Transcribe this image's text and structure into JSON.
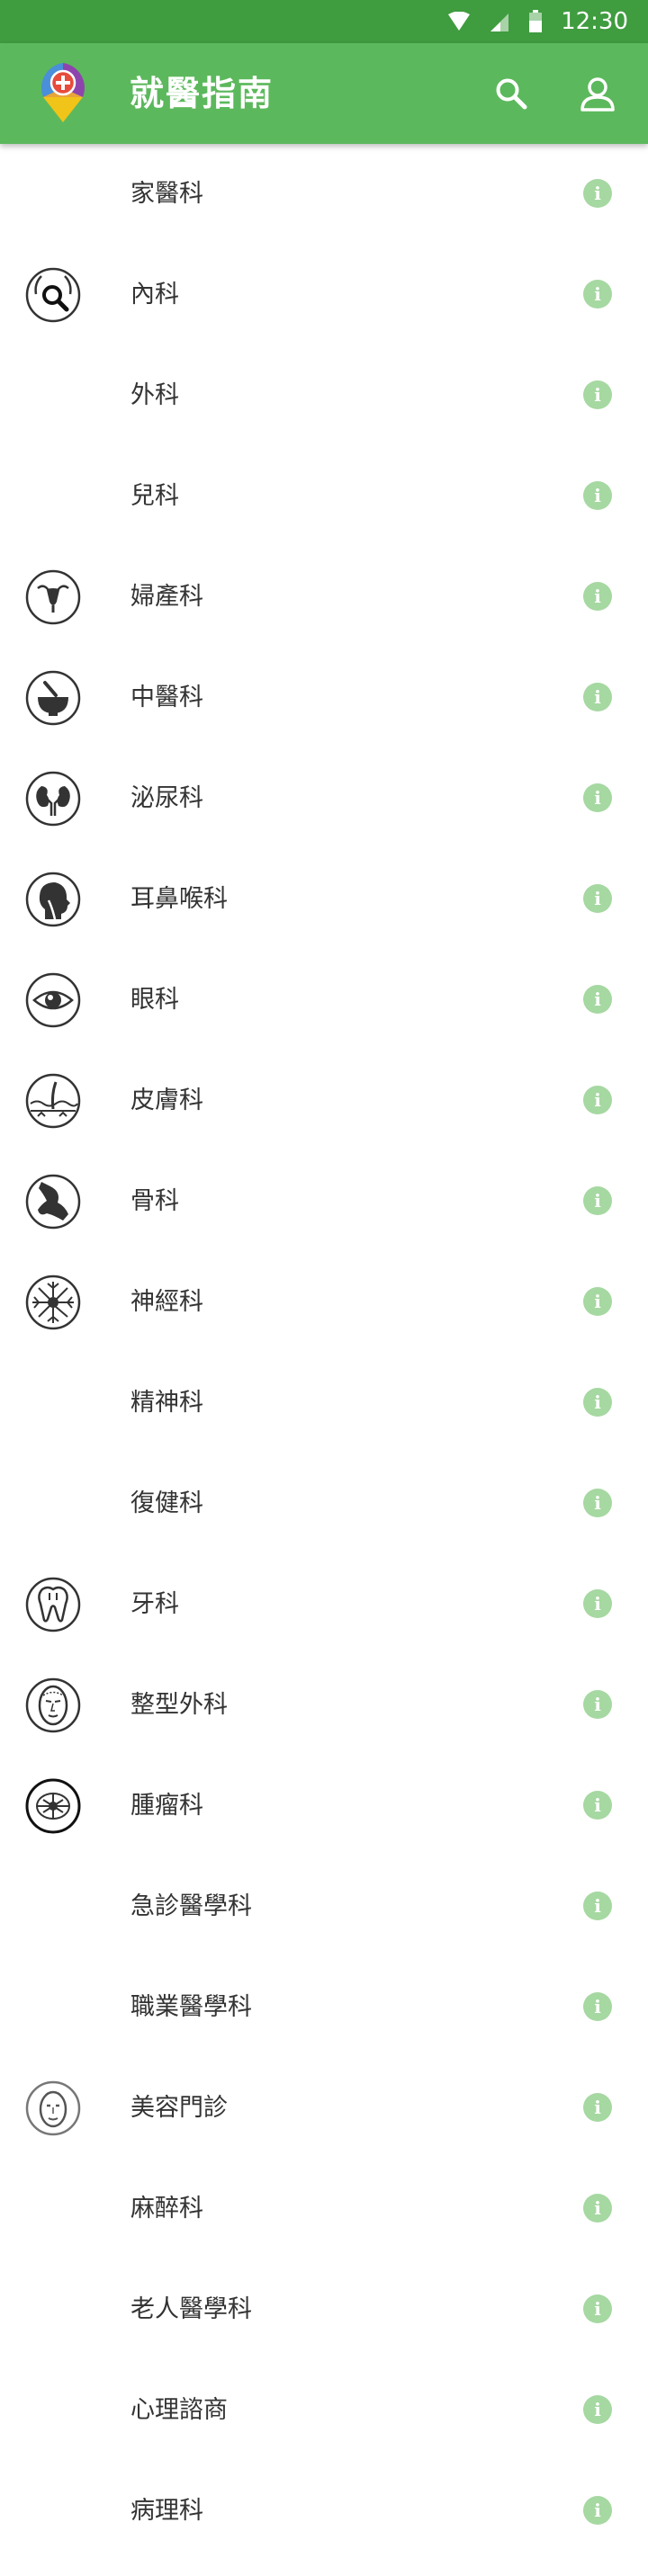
{
  "status_bar": {
    "time": "12:30"
  },
  "app_bar": {
    "title": "就醫指南"
  },
  "colors": {
    "status_bar": "#3f9c3f",
    "app_bar": "#5cb85c",
    "info_badge": "#a6d8a1",
    "text": "#333333"
  },
  "departments": [
    {
      "label": "家醫科",
      "icon": null
    },
    {
      "label": "內科",
      "icon": "internal-medicine-icon"
    },
    {
      "label": "外科",
      "icon": null
    },
    {
      "label": "兒科",
      "icon": null
    },
    {
      "label": "婦產科",
      "icon": "uterus-icon"
    },
    {
      "label": "中醫科",
      "icon": "mortar-pestle-icon"
    },
    {
      "label": "泌尿科",
      "icon": "kidney-icon"
    },
    {
      "label": "耳鼻喉科",
      "icon": "ent-head-icon"
    },
    {
      "label": "眼科",
      "icon": "eye-icon"
    },
    {
      "label": "皮膚科",
      "icon": "skin-icon"
    },
    {
      "label": "骨科",
      "icon": "bone-joint-icon"
    },
    {
      "label": "神經科",
      "icon": "neuron-icon"
    },
    {
      "label": "精神科",
      "icon": null
    },
    {
      "label": "復健科",
      "icon": null
    },
    {
      "label": "牙科",
      "icon": "tooth-icon"
    },
    {
      "label": "整型外科",
      "icon": "face-outline-icon"
    },
    {
      "label": "腫瘤科",
      "icon": "tumor-icon"
    },
    {
      "label": "急診醫學科",
      "icon": null
    },
    {
      "label": "職業醫學科",
      "icon": null
    },
    {
      "label": "美容門診",
      "icon": "face-icon"
    },
    {
      "label": "麻醉科",
      "icon": null
    },
    {
      "label": "老人醫學科",
      "icon": null
    },
    {
      "label": "心理諮商",
      "icon": null
    },
    {
      "label": "病理科",
      "icon": null
    }
  ]
}
